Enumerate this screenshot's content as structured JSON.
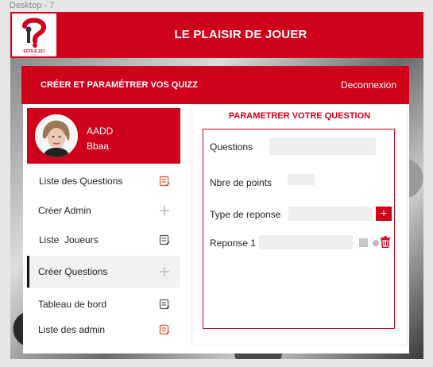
{
  "artboard": {
    "label": "Desktop - 7"
  },
  "header": {
    "title": "LE PLAISIR DE JOUER",
    "logo": {
      "icon": "question-mark-logo",
      "text": "ECOLE 221",
      "subtext": "SA221"
    }
  },
  "subheader": {
    "title": "CRÉER ET PARAMÉTRER VOS QUIZZ",
    "logout": "Deconnexion"
  },
  "profile": {
    "name": "AADD",
    "subtitle": "Bbaa"
  },
  "sidebar": {
    "items": [
      {
        "label": "Liste des Questions",
        "icon": "list-edit-icon",
        "active": false
      },
      {
        "label": "Créer Admin",
        "icon": "plus-icon",
        "active": false
      },
      {
        "label": "Liste  Joueurs",
        "icon": "list-edit-icon",
        "active": false
      },
      {
        "label": "Créer Questions",
        "icon": "plus-icon",
        "active": true
      },
      {
        "label": "Tableau de bord",
        "icon": "list-edit-icon",
        "active": false
      },
      {
        "label": "Liste des admin",
        "icon": "list-edit-icon",
        "active": false
      }
    ]
  },
  "form": {
    "title": "PARAMETRER VOTRE QUESTION",
    "questions_label": "Questions",
    "questions_value": "",
    "points_label": "Nbre de points",
    "points_value": "",
    "type_label": "Type de reponse",
    "type_value": "",
    "add_button": "+",
    "response_label": "Reponse 1",
    "response_value": ""
  },
  "colors": {
    "brand_red": "#d0021b",
    "input_grey": "#eeeeee",
    "icon_red": "#e8502f"
  }
}
